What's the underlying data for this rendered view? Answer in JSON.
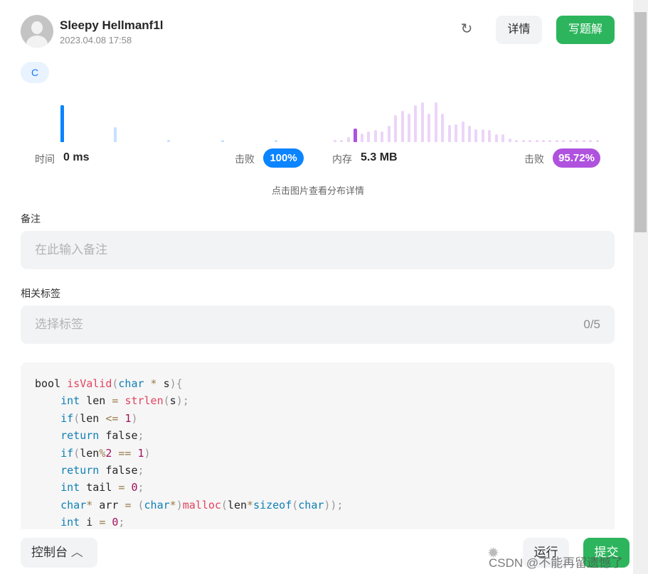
{
  "header": {
    "username": "Sleepy Hellmanf1l",
    "date": "2023.04.08 17:58",
    "detail_label": "详情",
    "write_label": "写题解"
  },
  "language": "C",
  "stats": {
    "time_label": "时间",
    "time_value": "0 ms",
    "time_beat_label": "击败",
    "time_beat": "100%",
    "mem_label": "内存",
    "mem_value": "5.3 MB",
    "mem_beat_label": "击败",
    "mem_beat": "95.72%",
    "hint": "点击图片查看分布详情"
  },
  "chart_data": [
    {
      "type": "bar",
      "name": "time-distribution",
      "values": [
        52,
        21,
        3,
        3,
        3
      ],
      "highlight_index": 0,
      "colors": {
        "highlight": "#0a84ff",
        "normal": "#c6e0ff"
      }
    },
    {
      "type": "bar",
      "name": "memory-distribution",
      "values": [
        3,
        3,
        7,
        19,
        12,
        15,
        17,
        15,
        23,
        38,
        44,
        40,
        52,
        56,
        40,
        56,
        40,
        24,
        25,
        29,
        23,
        18,
        18,
        17,
        11,
        11,
        5,
        3,
        3,
        3,
        3,
        3,
        3,
        3,
        3,
        3,
        3,
        3,
        3,
        3
      ],
      "highlight_index": 3,
      "colors": {
        "highlight": "#af52de",
        "normal": "#ecd4f8"
      }
    }
  ],
  "notes": {
    "label": "备注",
    "placeholder": "在此输入备注"
  },
  "tags": {
    "label": "相关标签",
    "placeholder": "选择标签",
    "count": "0/5"
  },
  "code_lines": [
    [
      [
        "",
        "bool "
      ],
      [
        "fn",
        "isValid"
      ],
      [
        "pu",
        "("
      ],
      [
        "kw",
        "char"
      ],
      [
        "op",
        " * "
      ],
      [
        "",
        "s"
      ],
      [
        "pu",
        "){"
      ]
    ],
    [
      [
        "",
        "    "
      ],
      [
        "kw",
        "int"
      ],
      [
        "",
        " len "
      ],
      [
        "op",
        "="
      ],
      [
        "",
        " "
      ],
      [
        "fn",
        "strlen"
      ],
      [
        "pu",
        "("
      ],
      [
        "",
        "s"
      ],
      [
        "pu",
        ");"
      ]
    ],
    [
      [
        "",
        "    "
      ],
      [
        "kw",
        "if"
      ],
      [
        "pu",
        "("
      ],
      [
        "",
        "len "
      ],
      [
        "op",
        "<="
      ],
      [
        "",
        " "
      ],
      [
        "nu",
        "1"
      ],
      [
        "pu",
        ")"
      ]
    ],
    [
      [
        "",
        "    "
      ],
      [
        "kw",
        "return"
      ],
      [
        "",
        " false"
      ],
      [
        "pu",
        ";"
      ]
    ],
    [
      [
        "",
        "    "
      ],
      [
        "kw",
        "if"
      ],
      [
        "pu",
        "("
      ],
      [
        "",
        "len"
      ],
      [
        "op",
        "%"
      ],
      [
        "nu",
        "2"
      ],
      [
        "",
        " "
      ],
      [
        "op",
        "=="
      ],
      [
        "",
        " "
      ],
      [
        "nu",
        "1"
      ],
      [
        "pu",
        ")"
      ]
    ],
    [
      [
        "",
        "    "
      ],
      [
        "kw",
        "return"
      ],
      [
        "",
        " false"
      ],
      [
        "pu",
        ";"
      ]
    ],
    [
      [
        "",
        "    "
      ],
      [
        "kw",
        "int"
      ],
      [
        "",
        " tail "
      ],
      [
        "op",
        "="
      ],
      [
        "",
        " "
      ],
      [
        "nu",
        "0"
      ],
      [
        "pu",
        ";"
      ]
    ],
    [
      [
        "",
        "    "
      ],
      [
        "kw",
        "char"
      ],
      [
        "op",
        "*"
      ],
      [
        "",
        " arr "
      ],
      [
        "op",
        "="
      ],
      [
        "",
        " "
      ],
      [
        "pu",
        "("
      ],
      [
        "kw",
        "char"
      ],
      [
        "op",
        "*"
      ],
      [
        "pu",
        ")"
      ],
      [
        "fn",
        "malloc"
      ],
      [
        "pu",
        "("
      ],
      [
        "",
        "len"
      ],
      [
        "op",
        "*"
      ],
      [
        "kw",
        "sizeof"
      ],
      [
        "pu",
        "("
      ],
      [
        "kw",
        "char"
      ],
      [
        "pu",
        "));"
      ]
    ],
    [
      [
        "",
        "    "
      ],
      [
        "kw",
        "int"
      ],
      [
        "",
        " i "
      ],
      [
        "op",
        "="
      ],
      [
        "",
        " "
      ],
      [
        "nu",
        "0"
      ],
      [
        "pu",
        ";"
      ]
    ]
  ],
  "footer": {
    "console_label": "控制台",
    "run_label": "运行",
    "submit_label": "提交"
  },
  "watermark": "CSDN @不能再留遗憾了"
}
